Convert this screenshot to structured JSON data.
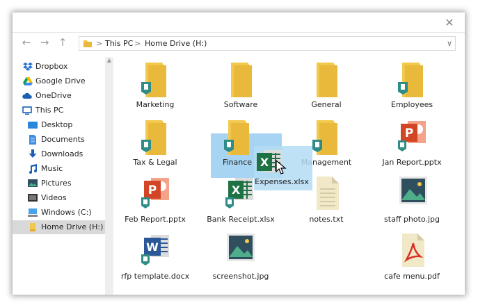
{
  "window": {
    "close_icon": "close-icon"
  },
  "nav": {
    "back_icon": "arrow-left-icon",
    "forward_icon": "arrow-right-icon",
    "up_icon": "arrow-up-icon"
  },
  "address": {
    "crumb1": "This PC",
    "crumb2": "Home Drive (H:)",
    "dropdown_icon": "chevron-down-icon"
  },
  "sidebar": {
    "items": [
      {
        "label": "Dropbox",
        "icon": "dropbox-icon"
      },
      {
        "label": "Google Drive",
        "icon": "google-drive-icon"
      },
      {
        "label": "OneDrive",
        "icon": "onedrive-icon"
      },
      {
        "label": "This PC",
        "icon": "computer-icon"
      },
      {
        "label": "Desktop",
        "icon": "desktop-icon"
      },
      {
        "label": "Documents",
        "icon": "documents-icon"
      },
      {
        "label": "Downloads",
        "icon": "download-icon"
      },
      {
        "label": "Music",
        "icon": "music-icon"
      },
      {
        "label": "Pictures",
        "icon": "pictures-icon"
      },
      {
        "label": "Videos",
        "icon": "videos-icon"
      },
      {
        "label": "Windows (C:)",
        "icon": "windows-drive-icon"
      },
      {
        "label": "Home Drive (H:)",
        "icon": "drive-icon",
        "selected": true
      }
    ]
  },
  "files": [
    {
      "label": "Marketing",
      "type": "folder"
    },
    {
      "label": "Software",
      "type": "folder"
    },
    {
      "label": "General",
      "type": "folder"
    },
    {
      "label": "Employees",
      "type": "folder"
    },
    {
      "label": "Tax & Legal",
      "type": "folder"
    },
    {
      "label": "Finance",
      "type": "folder",
      "selected": true
    },
    {
      "label": "Management",
      "type": "folder"
    },
    {
      "label": "Jan Report.pptx",
      "type": "powerpoint"
    },
    {
      "label": "Feb Report.pptx",
      "type": "powerpoint"
    },
    {
      "label": "Bank Receipt.xlsx",
      "type": "excel"
    },
    {
      "label": "notes.txt",
      "type": "text"
    },
    {
      "label": "staff photo.jpg",
      "type": "image"
    },
    {
      "label": "rfp template.docx",
      "type": "word"
    },
    {
      "label": "screenshot.jpg",
      "type": "image"
    },
    {
      "label": "cafe menu.pdf",
      "type": "pdf"
    }
  ],
  "drag": {
    "label": "Expenses.xlsx",
    "type": "excel",
    "cursor_icon": "pointer-cursor-icon"
  },
  "colors": {
    "folder": "#f2c94c",
    "folder_dark": "#e0ad2a",
    "shield": "#2f8c86",
    "excel": "#1f7244",
    "powerpoint": "#d24625",
    "word": "#2b5797",
    "pdf": "#d93025",
    "selection": "#9fd2f3",
    "sidebar_selected": "#d9d9d9"
  }
}
